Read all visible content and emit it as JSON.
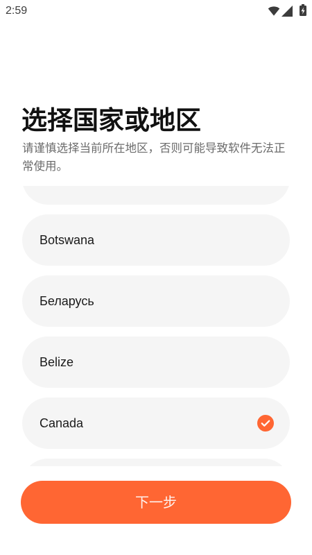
{
  "status_bar": {
    "time": "2:59",
    "icons": [
      "wifi-icon",
      "signal-icon",
      "battery-charging-icon"
    ]
  },
  "header": {
    "title": "选择国家或地区",
    "subtitle": "请谨慎选择当前所在地区，否则可能导致软件无法正常使用。"
  },
  "country_list": {
    "items": [
      {
        "selected": false
      },
      {
        "label": "Botswana",
        "selected": false
      },
      {
        "label": "Беларусь",
        "selected": false
      },
      {
        "label": "Belize",
        "selected": false
      },
      {
        "label": "Canada",
        "selected": true
      },
      {
        "selected": false
      }
    ],
    "selected_icon": "check-circle-icon"
  },
  "next_button": {
    "label": "下一步"
  },
  "colors": {
    "accent": "#ff6633",
    "item_background": "#f5f5f5",
    "text": "#1a1a1a",
    "muted_text": "#6b6b6b"
  }
}
